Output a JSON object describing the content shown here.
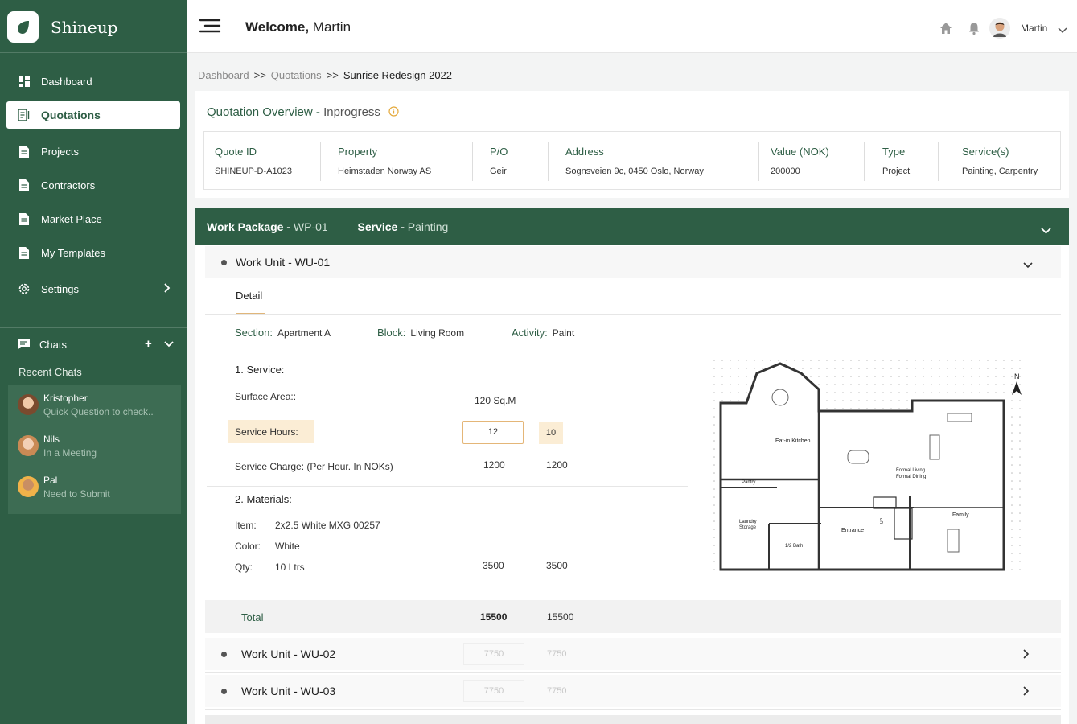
{
  "app": {
    "brand": "Shineup"
  },
  "sidebar": {
    "items": [
      {
        "label": "Dashboard",
        "icon": "dashboard-icon"
      },
      {
        "label": "Quotations",
        "icon": "quotation-icon",
        "active": true
      },
      {
        "label": "Projects",
        "icon": "document-icon"
      },
      {
        "label": "Contractors",
        "icon": "document-icon"
      },
      {
        "label": "Market Place",
        "icon": "document-icon"
      },
      {
        "label": "My Templates",
        "icon": "document-icon"
      },
      {
        "label": "Settings",
        "icon": "gear-icon"
      }
    ],
    "chats_label": "Chats",
    "recent_label": "Recent Chats",
    "chats": [
      {
        "name": "Kristopher",
        "message": "Quick Question to check.."
      },
      {
        "name": "Nils",
        "message": "In a Meeting"
      },
      {
        "name": "Pal",
        "message": "Need to Submit"
      }
    ]
  },
  "topbar": {
    "welcome_prefix": "Welcome,",
    "welcome_name": "Martin",
    "user_name": "Martin"
  },
  "breadcrumb": [
    "Dashboard",
    "Quotations",
    "Sunrise Redesign 2022"
  ],
  "breadcrumb_sep": ">>",
  "overview": {
    "title": "Quotation Overview -",
    "status": "Inprogress",
    "columns": [
      {
        "header": "Quote ID",
        "value": "SHINEUP-D-A1023"
      },
      {
        "header": "Property",
        "value": "Heimstaden Norway AS"
      },
      {
        "header": "P/O",
        "value": "Geir"
      },
      {
        "header": "Address",
        "value": "Sognsveien 9c, 0450 Oslo, Norway"
      },
      {
        "header": "Value (NOK)",
        "value": "200000"
      },
      {
        "header": "Type",
        "value": "Project"
      },
      {
        "header": "Service(s)",
        "value": "Painting, Carpentry"
      }
    ]
  },
  "work_package": {
    "label": "Work Package -",
    "id": "WP-01",
    "service_label": "Service -",
    "service": "Painting",
    "unit1": {
      "title": "Work Unit - WU-01",
      "tab": "Detail",
      "section_label": "Section:",
      "section": "Apartment A",
      "block_label": "Block:",
      "block": "Living Room",
      "activity_label": "Activity:",
      "activity": "Paint",
      "service_heading": "1. Service:",
      "surface_label": "Surface Area::",
      "surface_value": "120 Sq.M",
      "hours_label": "Service Hours:",
      "hours_input": "12",
      "hours_value": "10",
      "charge_label": "Service Charge: (Per Hour. In NOKs)",
      "charge_1": "1200",
      "charge_2": "1200",
      "materials_heading": "2. Materials:",
      "item_label": "Item:",
      "item_value": "2x2.5 White MXG 00257",
      "color_label": "Color:",
      "color_value": "White",
      "qty_label": "Qty:",
      "qty_value": "10 Ltrs",
      "qty_1": "3500",
      "qty_2": "3500",
      "total_label": "Total",
      "total_1": "15500",
      "total_2": "15500",
      "plan_labels": {
        "kitchen": "Eat-in Kitchen",
        "pantry": "Pantry",
        "living": "Formal Living",
        "dining": "Formal Dining",
        "laundry": "Laundry",
        "storage": "Storage",
        "bath": "1/2 Bath",
        "entrance": "Entrance",
        "family": "Family",
        "north": "N",
        "up": "UP"
      }
    },
    "unit2": {
      "title": "Work Unit - WU-02",
      "v1": "7750",
      "v2": "7750"
    },
    "unit3": {
      "title": "Work Unit - WU-03",
      "v1": "7750",
      "v2": "7750"
    }
  },
  "colors": {
    "brand_green": "#2e5e45",
    "accent_orange": "#e4b678",
    "highlight": "#fbedd5"
  }
}
